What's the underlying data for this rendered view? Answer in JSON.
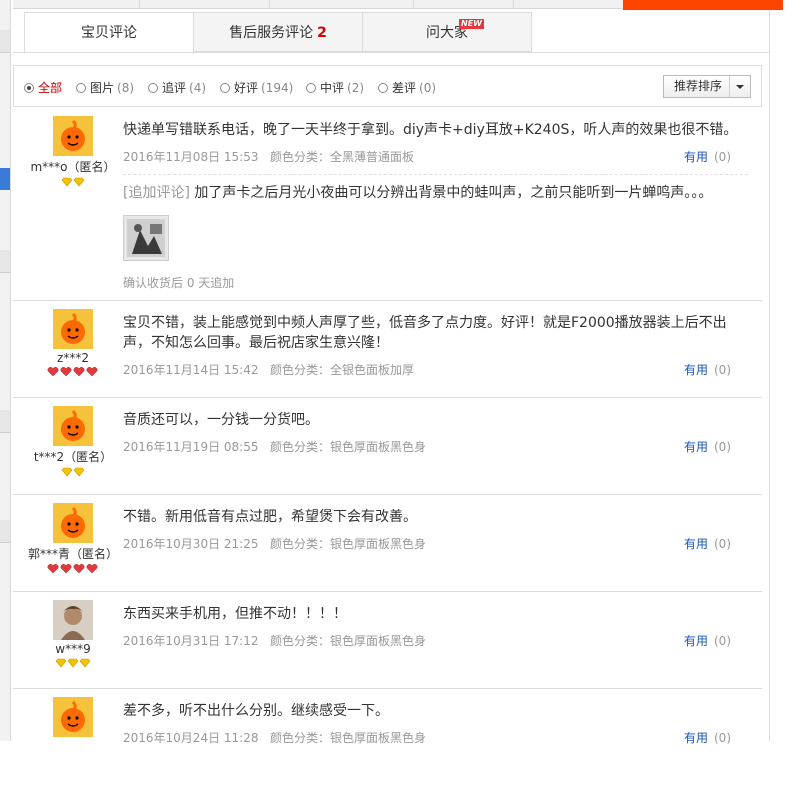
{
  "tabs": [
    {
      "label": "宝贝评论",
      "count": ""
    },
    {
      "label": "售后服务评论",
      "count": "2"
    },
    {
      "label": "问大家",
      "count": "",
      "badge": "NEW"
    }
  ],
  "filters": [
    {
      "label": "全部",
      "count": ""
    },
    {
      "label": "图片",
      "count": "(8)"
    },
    {
      "label": "追评",
      "count": "(4)"
    },
    {
      "label": "好评",
      "count": "(194)"
    },
    {
      "label": "中评",
      "count": "(2)"
    },
    {
      "label": "差评",
      "count": "(0)"
    }
  ],
  "sort": {
    "label": "推荐排序"
  },
  "useful_label": "有用",
  "reviews": [
    {
      "user": "m***o（匿名）",
      "level_icon": "diamond",
      "level_count": 2,
      "text": "快递单写错联系电话，晚了一天半终于拿到。diy声卡+diy耳放+K240S，听人声的效果也很不错。",
      "date": "2016年11月08日 15:53",
      "sku": "颜色分类：全黑薄普通面板",
      "useful_count": "(0)",
      "append_tag": "[追加评论]",
      "append_text": "加了声卡之后月光小夜曲可以分辨出背景中的蛙叫声，之前只能听到一片蝉鸣声。。。",
      "confirm": "确认收货后 0 天追加"
    },
    {
      "user": "z***2",
      "level_icon": "heart",
      "level_count": 4,
      "text": "宝贝不错，装上能感觉到中频人声厚了些，低音多了点力度。好评！就是F2000播放器装上后不出声，不知怎么回事。最后祝店家生意兴隆！",
      "date": "2016年11月14日 15:42",
      "sku": "颜色分类：全银色面板加厚",
      "useful_count": "(0)"
    },
    {
      "user": "t***2（匿名）",
      "level_icon": "diamond",
      "level_count": 2,
      "text": "音质还可以，一分钱一分货吧。",
      "date": "2016年11月19日 08:55",
      "sku": "颜色分类：银色厚面板黑色身",
      "useful_count": "(0)"
    },
    {
      "user": "郭***青（匿名）",
      "level_icon": "heart",
      "level_count": 4,
      "text": "不错。新用低音有点过肥，希望煲下会有改善。",
      "date": "2016年10月30日 21:25",
      "sku": "颜色分类：银色厚面板黑色身",
      "useful_count": "(0)"
    },
    {
      "user": "w***9",
      "level_icon": "diamond",
      "level_count": 3,
      "text": "东西买来手机用，但推不动！！！！",
      "date": "2016年10月31日 17:12",
      "sku": "颜色分类：银色厚面板黑色身",
      "useful_count": "(0)"
    },
    {
      "user": "",
      "level_icon": "",
      "level_count": 0,
      "text": "差不多，听不出什么分别。继续感受一下。",
      "date": "2016年10月24日 11:28",
      "sku": "颜色分类：银色厚面板黑色身",
      "useful_count": "(0)"
    }
  ],
  "colors": {
    "accent_red": "#cc0000",
    "link_blue": "#1a56b8",
    "brand_orange": "#ff4400"
  }
}
